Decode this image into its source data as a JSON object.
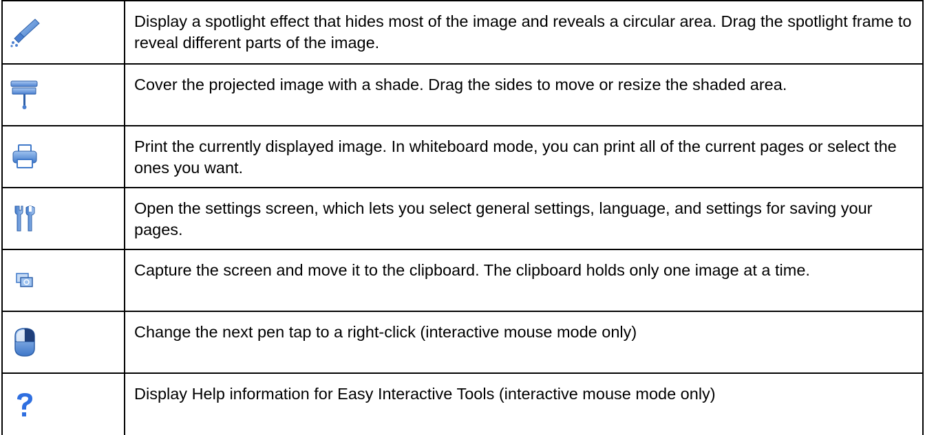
{
  "rows": [
    {
      "icon": "spotlight-icon",
      "text": "Display a spotlight effect that hides most of the image and reveals a circular area. Drag the spotlight frame to reveal different parts of the image."
    },
    {
      "icon": "shade-icon",
      "text": "Cover the projected image with a shade. Drag the sides to move or resize the shaded area."
    },
    {
      "icon": "printer-icon",
      "text": "Print the currently displayed image. In whiteboard mode, you can print all of the current pages or select the ones you want."
    },
    {
      "icon": "settings-tools-icon",
      "text": "Open the settings screen, which lets you select general settings, language, and settings for saving your pages."
    },
    {
      "icon": "screen-capture-icon",
      "text": "Capture the screen and move it to the clipboard. The clipboard holds only one image at a time."
    },
    {
      "icon": "mouse-right-click-icon",
      "text": "Change the next pen tap to a right-click (interactive mouse mode only)"
    },
    {
      "icon": "help-icon",
      "text": "Display Help information for Easy Interactive Tools (interactive mouse mode only)"
    }
  ],
  "colors": {
    "icon_blue": "#5b8fd6",
    "icon_dark_blue": "#1f4f9c",
    "help_blue": "#2f6fe0",
    "border": "#000000"
  }
}
